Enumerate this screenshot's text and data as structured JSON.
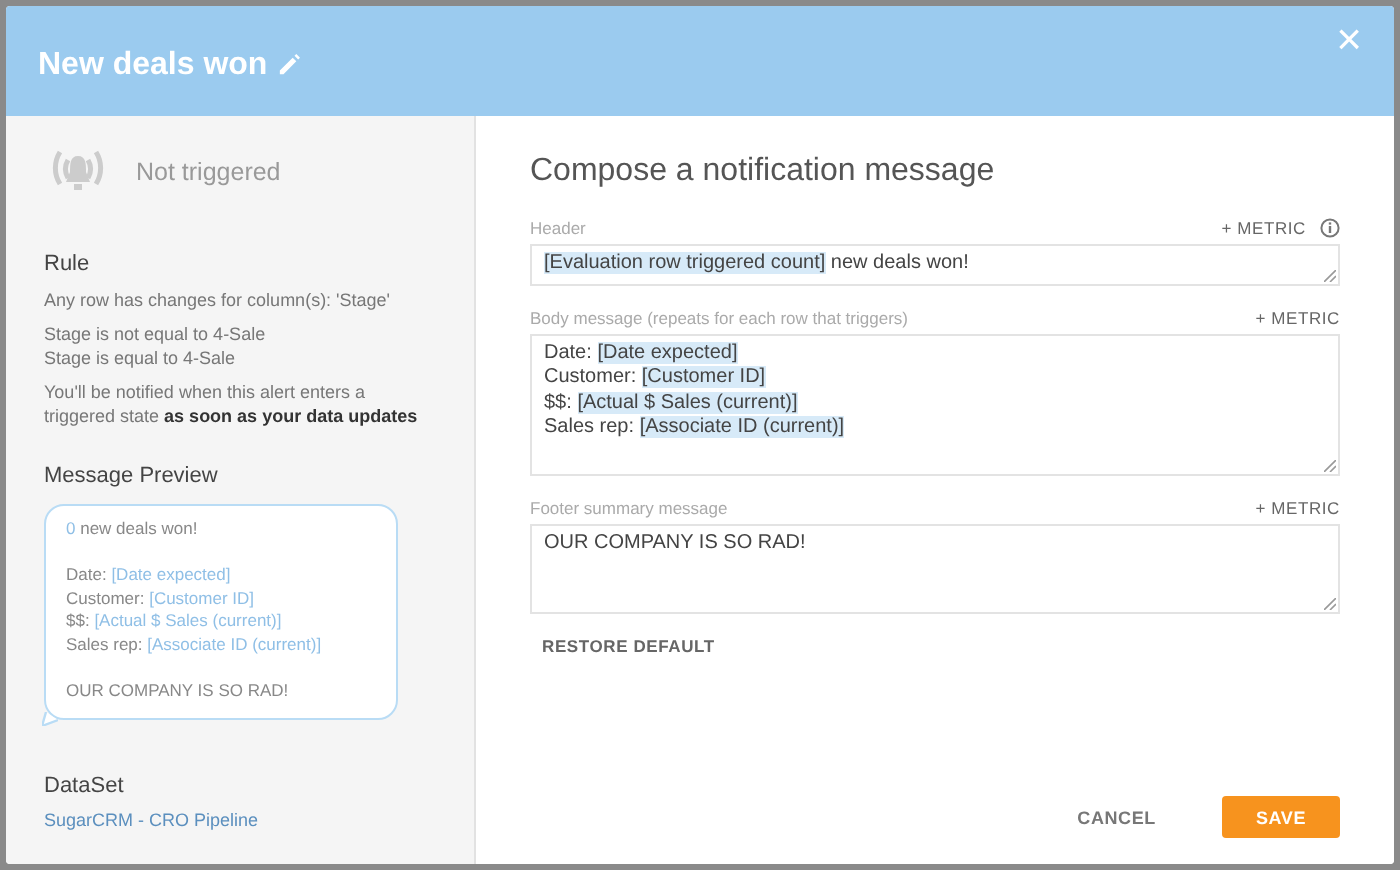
{
  "dialog": {
    "title": "New deals won",
    "close": "×"
  },
  "status": {
    "label": "Not triggered"
  },
  "rule": {
    "heading": "Rule",
    "description": "Any row has changes for column(s): 'Stage'",
    "conditions": [
      "Stage is not equal to 4-Sale",
      "Stage is equal to 4-Sale"
    ],
    "notice": "You'll be notified when this alert enters a triggered state **as soon as your data updates**"
  },
  "preview": {
    "heading": "Message Preview",
    "blocks": [
      [
        [
          {
            "text": "0",
            "metric": true
          },
          {
            "text": " new deals won!",
            "metric": false
          }
        ]
      ],
      [
        [
          {
            "text": "Date: ",
            "metric": false
          },
          {
            "text": "[Date expected]",
            "metric": true
          }
        ],
        [
          {
            "text": "Customer: ",
            "metric": false
          },
          {
            "text": "[Customer ID]",
            "metric": true
          }
        ],
        [
          {
            "text": "$$: ",
            "metric": false
          },
          {
            "text": "[Actual $ Sales (current)]",
            "metric": true
          }
        ],
        [
          {
            "text": "Sales rep: ",
            "metric": false
          },
          {
            "text": "[Associate ID (current)]",
            "metric": true
          }
        ]
      ],
      [
        [
          {
            "text": "OUR COMPANY IS SO RAD!",
            "metric": false
          }
        ]
      ]
    ]
  },
  "dataset": {
    "heading": "DataSet",
    "link": "SugarCRM - CRO Pipeline"
  },
  "compose": {
    "title": "Compose a notification message",
    "fields": [
      {
        "label": "Header",
        "metric_button": "+ METRIC",
        "info": true,
        "lines": [
          [
            {
              "text": "[Evaluation row triggered count]",
              "metric": true
            },
            {
              "text": " new deals won!",
              "metric": false
            }
          ]
        ]
      },
      {
        "label": "Body message (repeats for each row that triggers)",
        "metric_button": "+ METRIC",
        "info": false,
        "lines": [
          [
            {
              "text": "Date: ",
              "metric": false
            },
            {
              "text": "[Date expected]",
              "metric": true
            }
          ],
          [
            {
              "text": "Customer: ",
              "metric": false
            },
            {
              "text": "[Customer ID]",
              "metric": true
            }
          ],
          [
            {
              "text": "$$: ",
              "metric": false
            },
            {
              "text": "[Actual $ Sales (current)]",
              "metric": true
            }
          ],
          [
            {
              "text": "Sales rep: ",
              "metric": false
            },
            {
              "text": "[Associate ID (current)]",
              "metric": true
            }
          ]
        ]
      },
      {
        "label": "Footer summary message",
        "metric_button": "+ METRIC",
        "info": false,
        "lines": [
          [
            {
              "text": "OUR COMPANY IS SO RAD!",
              "metric": false
            }
          ]
        ]
      }
    ],
    "restore": "RESTORE DEFAULT"
  },
  "buttons": [
    {
      "label": "CANCEL",
      "kind": "secondary"
    },
    {
      "label": "SAVE",
      "kind": "primary"
    }
  ]
}
